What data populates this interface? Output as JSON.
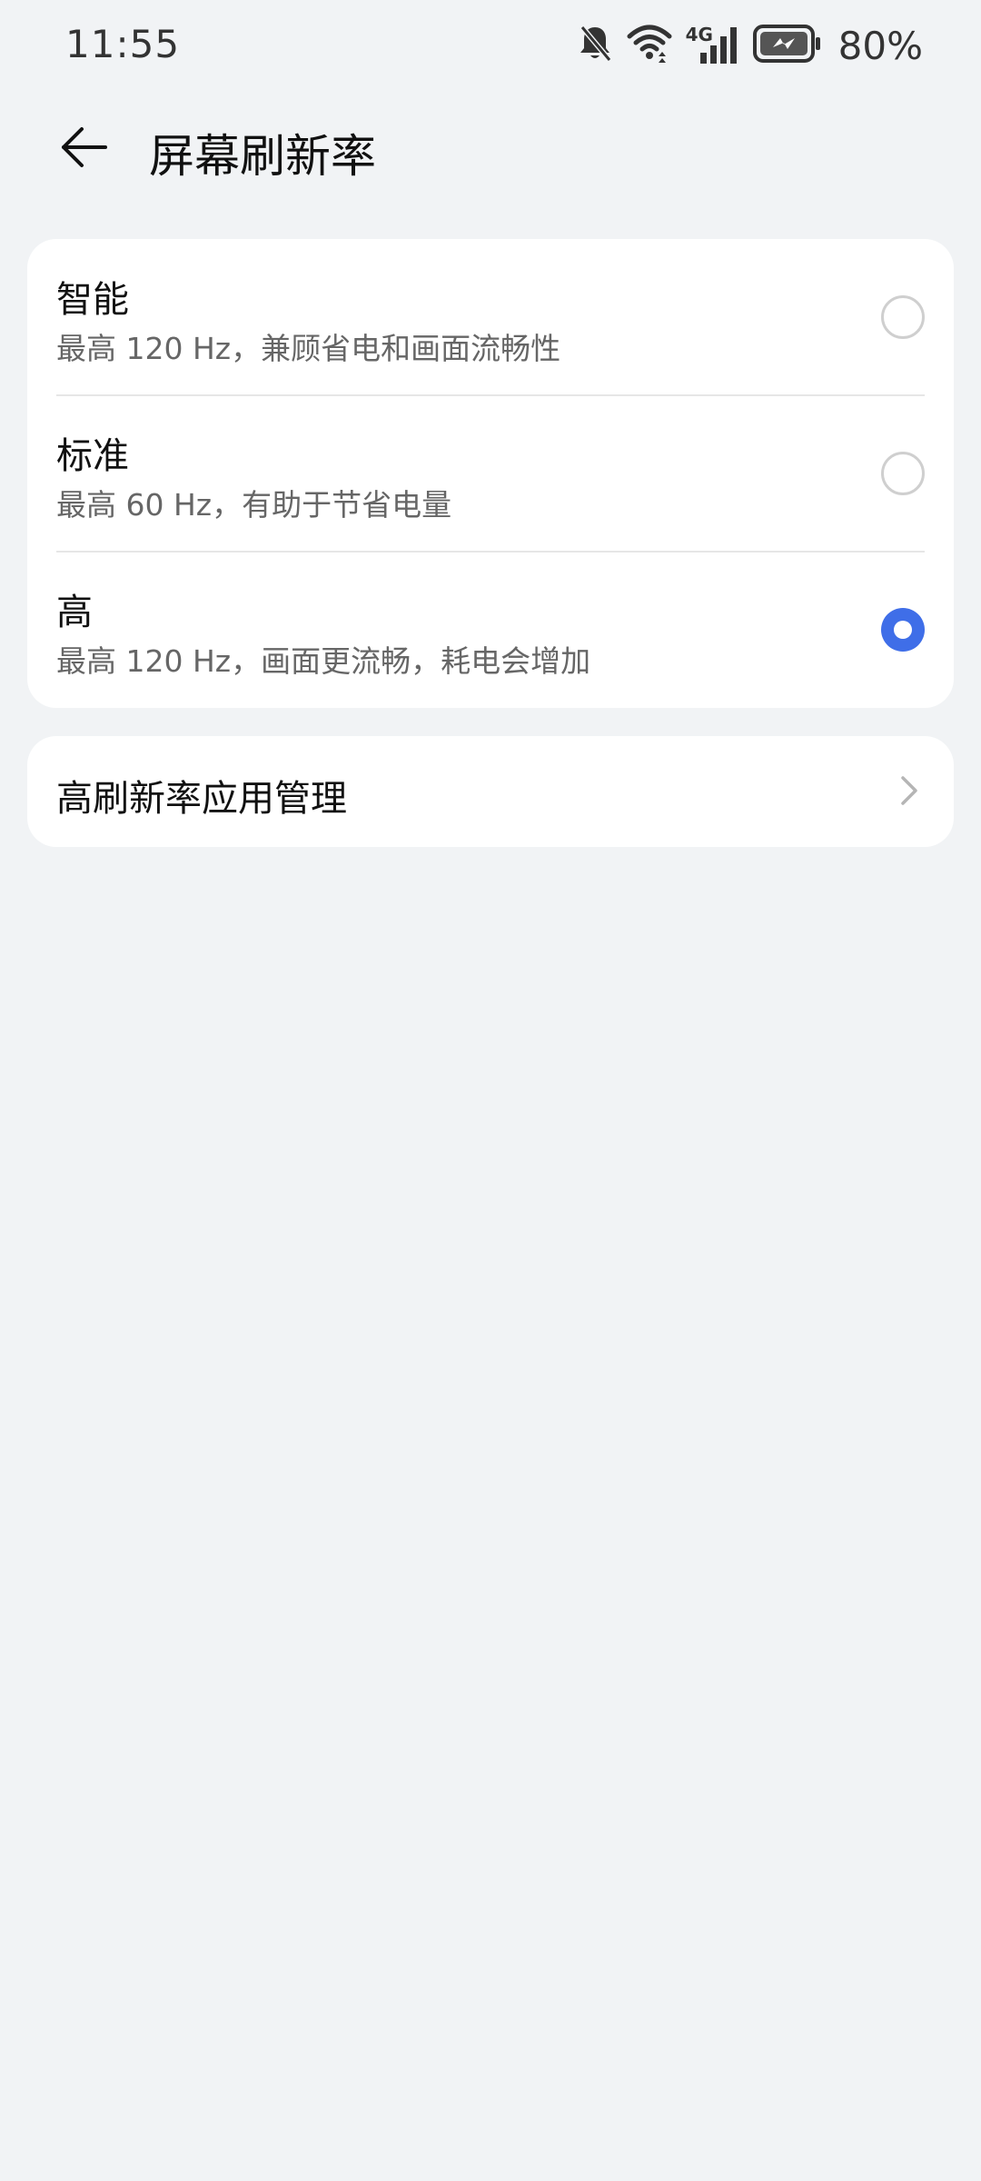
{
  "status_bar": {
    "time": "11:55",
    "battery_percent": "80%",
    "network_label": "4G",
    "icons": [
      "bell-off-icon",
      "wifi-icon",
      "cellular-4g-icon",
      "battery-charging-icon"
    ]
  },
  "header": {
    "title": "屏幕刷新率",
    "back_icon": "arrow-left-icon"
  },
  "refresh_options": [
    {
      "title": "智能",
      "description": "最高 120 Hz，兼顾省电和画面流畅性",
      "selected": false
    },
    {
      "title": "标准",
      "description": "最高 60 Hz，有助于节省电量",
      "selected": false
    },
    {
      "title": "高",
      "description": "最高 120 Hz，画面更流畅，耗电会增加",
      "selected": true
    }
  ],
  "app_management": {
    "label": "高刷新率应用管理",
    "icon": "chevron-right-icon"
  },
  "colors": {
    "accent": "#3f6ee8",
    "background": "#f1f3f5",
    "card": "#ffffff"
  }
}
